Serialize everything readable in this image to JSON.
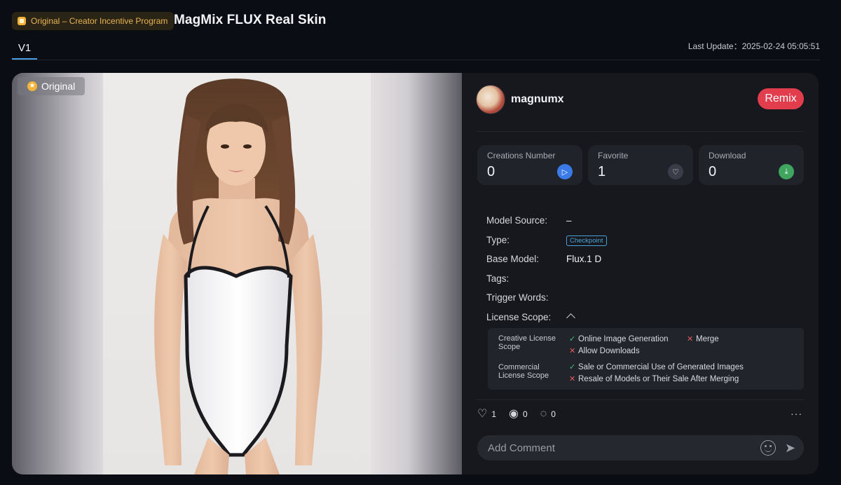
{
  "header": {
    "badge": "Original – Creator Incentive Program",
    "title": "MagMix FLUX Real Skin",
    "version_tab": "V1",
    "last_update": "Last Update：2025-02-24 05:05:51"
  },
  "image": {
    "chip": "Original"
  },
  "author": {
    "name": "magnumx",
    "remix_label": "Remix"
  },
  "stats": [
    {
      "label": "Creations Number",
      "value": "0",
      "icon": "play-icon",
      "color": "#3b7be8"
    },
    {
      "label": "Favorite",
      "value": "1",
      "icon": "heart-icon",
      "color": "#3a3d47"
    },
    {
      "label": "Download",
      "value": "0",
      "icon": "download-icon",
      "color": "#3fa55f"
    }
  ],
  "details": {
    "model_source_label": "Model Source:",
    "model_source_value": "–",
    "type_label": "Type:",
    "type_value": "Checkpoint",
    "base_model_label": "Base Model:",
    "base_model_value": "Flux.1 D",
    "tags_label": "Tags:",
    "trigger_words_label": "Trigger Words:",
    "license_scope_label": "License Scope:"
  },
  "license": {
    "creative_label": "Creative License Scope",
    "online_generation": "Online Image Generation",
    "merge": "Merge",
    "allow_downloads": "Allow Downloads",
    "commercial_label": "Commercial License Scope",
    "sale_commercial": "Sale or Commercial Use of Generated Images",
    "resale_models": "Resale of Models or Their Sale After Merging"
  },
  "actions": {
    "likes": "1",
    "views": "0",
    "comments": "0",
    "more": "···"
  },
  "comment": {
    "placeholder": "Add Comment"
  }
}
